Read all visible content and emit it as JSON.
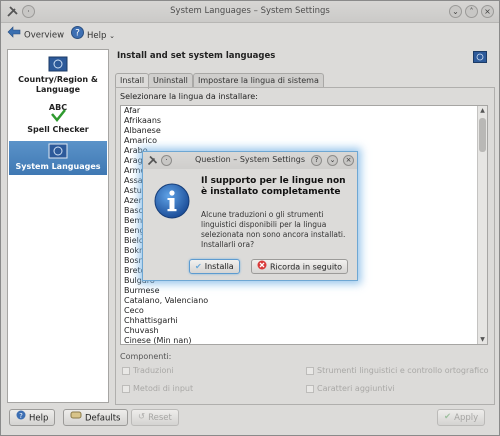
{
  "window": {
    "title": "System Languages – System Settings"
  },
  "toolbar": {
    "overview_label": "Overview",
    "help_label": "Help"
  },
  "sidebar": {
    "items": [
      {
        "label": "Country/Region & Language",
        "icon": "flag-icon"
      },
      {
        "label": "Spell Checker",
        "icon": "abc-check-icon"
      },
      {
        "label": "System Languages",
        "icon": "flag-icon"
      }
    ]
  },
  "main": {
    "title": "Install and set system languages",
    "tabs": [
      {
        "label": "Install"
      },
      {
        "label": "Uninstall"
      },
      {
        "label": "Impostare la lingua di sistema"
      }
    ],
    "list_label": "Selezionare la lingua da installare:",
    "languages": [
      "Afar",
      "Afrikaans",
      "Albanese",
      "Amarico",
      "Arabo",
      "Aragonese",
      "Armeno",
      "Assamese",
      "Asturiano",
      "Azero",
      "Basco",
      "Bembe",
      "Bengali",
      "Bielorusso",
      "Bokmål",
      "Bosniaco",
      "Bretone",
      "Bulgaro",
      "Burmese",
      "Catalano, Valenciano",
      "Ceco",
      "Chhattisgarhi",
      "Chuvash",
      "Cinese (Min nan)"
    ],
    "components_label": "Componenti:",
    "components": [
      {
        "label": "Traduzioni"
      },
      {
        "label": "Strumenti linguistici e controllo ortografico"
      },
      {
        "label": "Metodi di input"
      },
      {
        "label": "Caratteri aggiuntivi"
      }
    ]
  },
  "bottom": {
    "help_label": "Help",
    "defaults_label": "Defaults",
    "reset_label": "Reset",
    "apply_label": "Apply"
  },
  "dialog": {
    "title": "Question – System Settings",
    "heading": "Il supporto per le lingue non è installato completamente",
    "body": "Alcune traduzioni o gli strumenti linguistici disponibili per la lingua selezionata non sono ancora installati. Installarli ora?",
    "install_label": "Installa",
    "later_label": "Ricorda in seguito"
  }
}
